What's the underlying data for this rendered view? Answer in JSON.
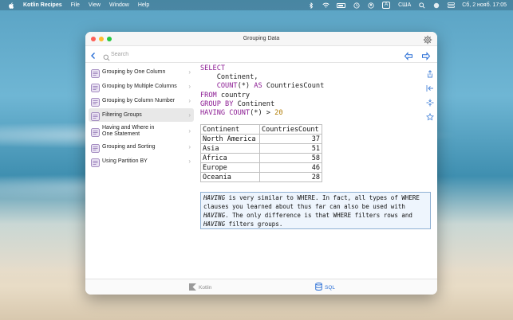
{
  "menubar": {
    "app_name": "Kotlin Recipes",
    "menus": [
      "File",
      "View",
      "Window",
      "Help"
    ],
    "keyboard_badge": "A",
    "input_source": "США",
    "clock": "Сб, 2 нояб. 17:05"
  },
  "window": {
    "title": "Grouping Data"
  },
  "search": {
    "placeholder": "Search"
  },
  "sidebar": {
    "items": [
      {
        "label": "Grouping by One Column"
      },
      {
        "label": "Grouping by Multiple Columns"
      },
      {
        "label": "Grouping by Column Number"
      },
      {
        "label": "Filtering Groups",
        "selected": true
      },
      {
        "label": "Having and Where in\nOne Statement"
      },
      {
        "label": "Grouping and Sorting"
      },
      {
        "label": "Using Partition BY"
      }
    ]
  },
  "sql": {
    "kw_select": "SELECT",
    "col1": "Continent,",
    "kw_count": "COUNT",
    "count_arg": "(*) ",
    "kw_as": "AS",
    "alias": " CountriesCount",
    "kw_from": "FROM",
    "table": " country",
    "kw_group_by": "GROUP BY",
    "group_col": " Continent",
    "kw_having": "HAVING",
    "kw_count2": "COUNT",
    "having_cond": "(*) > ",
    "having_value": "20"
  },
  "result": {
    "headers": [
      "Continent",
      "CountriesCount"
    ],
    "rows": [
      [
        "North America",
        "37"
      ],
      [
        "Asia",
        "51"
      ],
      [
        "Africa",
        "58"
      ],
      [
        "Europe",
        "46"
      ],
      [
        "Oceania",
        "28"
      ]
    ]
  },
  "note": {
    "having1": "HAVING",
    "text1": " is very similar to WHERE. In fact, all types of WHERE clauses you learned about thus far can also be used with ",
    "having2": "HAVING",
    "text2": ". The only difference is that WHERE filters rows and ",
    "having3": "HAVING",
    "text3": " filters groups."
  },
  "tabs": {
    "kotlin": "Kotlin",
    "sql": "SQL",
    "active": "SQL"
  },
  "colors": {
    "keyword": "#8c1d94",
    "number": "#b07b00",
    "accent": "#2a6fd6",
    "note_bg": "#eef5fd"
  }
}
